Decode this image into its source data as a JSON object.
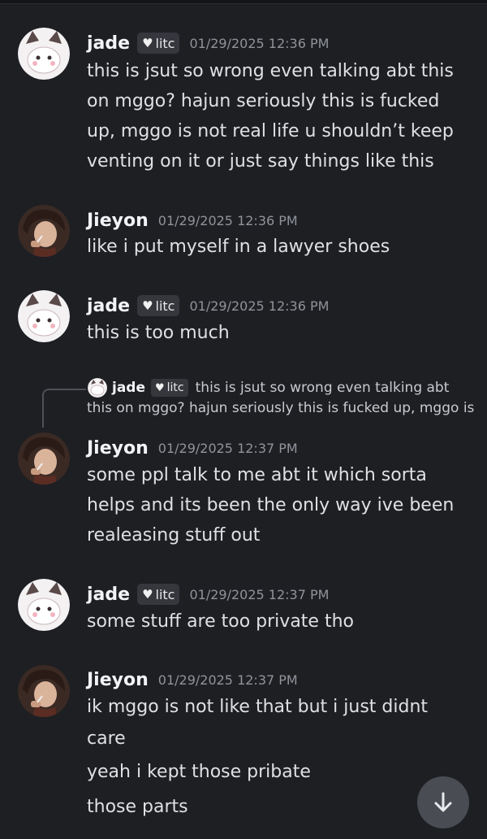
{
  "users": {
    "jade": {
      "name": "jade",
      "tag": "litc"
    },
    "jieyon": {
      "name": "Jieyon"
    }
  },
  "messages": [
    {
      "author": "jade",
      "timestamp": "01/29/2025 12:36 PM",
      "lines": [
        "this is jsut so wrong even talking abt this",
        "on mggo? hajun seriously this is fucked",
        "up, mggo is not real life u shouldn’t keep",
        "venting on it or just say things like this"
      ]
    },
    {
      "author": "Jieyon",
      "timestamp": "01/29/2025 12:36 PM",
      "lines": [
        "like i put myself in a lawyer shoes"
      ]
    },
    {
      "author": "jade",
      "timestamp": "01/29/2025 12:36 PM",
      "lines": [
        "this is too much"
      ]
    },
    {
      "author": "Jieyon",
      "timestamp": "01/29/2025 12:37 PM",
      "reply": {
        "author": "jade",
        "tag": "litc",
        "text_line1": "this is jsut so wrong even talking abt",
        "text_line2": "this on mggo? hajun seriously this is fucked up, mggo is"
      },
      "lines": [
        "some ppl talk to me abt it which sorta",
        "helps and its been the only way ive been",
        "realeasing stuff out"
      ]
    },
    {
      "author": "jade",
      "timestamp": "01/29/2025 12:37 PM",
      "lines": [
        "some stuff are too private tho"
      ]
    },
    {
      "author": "Jieyon",
      "timestamp": "01/29/2025 12:37 PM",
      "lines": [
        "ik mggo is not like that but i just didnt",
        "care",
        "yeah i kept those pribate",
        "those parts"
      ]
    }
  ],
  "icons": {
    "tag_icon": "heart-icon",
    "scroll_button": "arrow-down-icon"
  },
  "colors": {
    "background": "#1e1f23",
    "tag_background": "#36373d",
    "timestamp": "#90939a"
  }
}
